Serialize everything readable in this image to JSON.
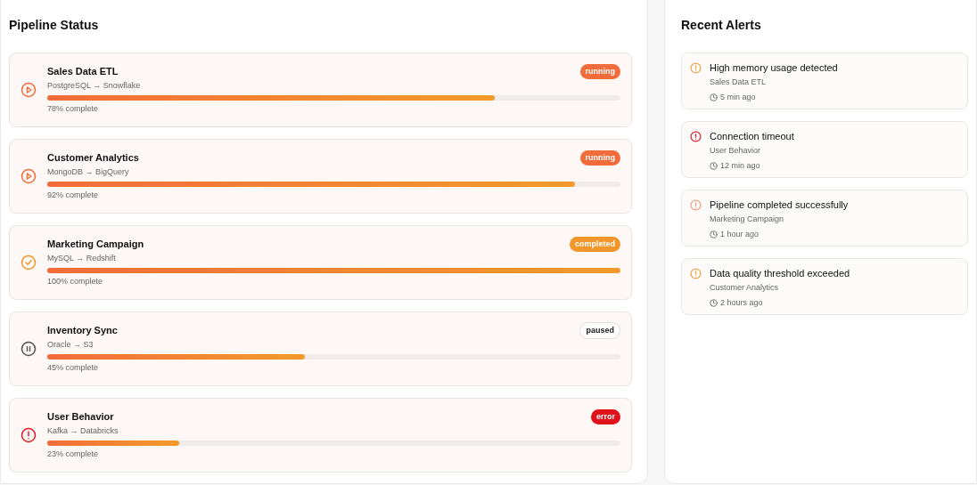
{
  "pipelines": {
    "title": "Pipeline Status",
    "items": [
      {
        "name": "Sales Data ETL",
        "route": "PostgreSQL → Snowflake",
        "kind": "running",
        "badge": "running",
        "level": 0.78,
        "progress": "78% complete"
      },
      {
        "name": "Customer Analytics",
        "route": "MongoDB → BigQuery",
        "kind": "running",
        "badge": "running",
        "level": 0.92,
        "progress": "92% complete"
      },
      {
        "name": "Marketing Campaign",
        "route": "MySQL → Redshift",
        "kind": "completed",
        "badge": "completed",
        "level": 1,
        "progress": "100% complete"
      },
      {
        "name": "Inventory Sync",
        "route": "Oracle → S3",
        "kind": "paused",
        "badge": "paused",
        "level": 0.45,
        "progress": "45% complete"
      },
      {
        "name": "User Behavior",
        "route": "Kafka → Databricks",
        "kind": "error",
        "badge": "error",
        "level": 0.23,
        "progress": "23% complete"
      }
    ]
  },
  "alerts": {
    "title": "Recent Alerts",
    "items": [
      {
        "kind": "warning",
        "title": "High memory usage detected",
        "pipeline": "Sales Data ETL",
        "time": "5 min ago"
      },
      {
        "kind": "error",
        "title": "Connection timeout",
        "pipeline": "User Behavior",
        "time": "12 min ago"
      },
      {
        "kind": "success",
        "title": "Pipeline completed successfully",
        "pipeline": "Marketing Campaign",
        "time": "1 hour ago"
      },
      {
        "kind": "warning",
        "title": "Data quality threshold exceeded",
        "pipeline": "Customer Analytics",
        "time": "2 hours ago"
      }
    ]
  }
}
